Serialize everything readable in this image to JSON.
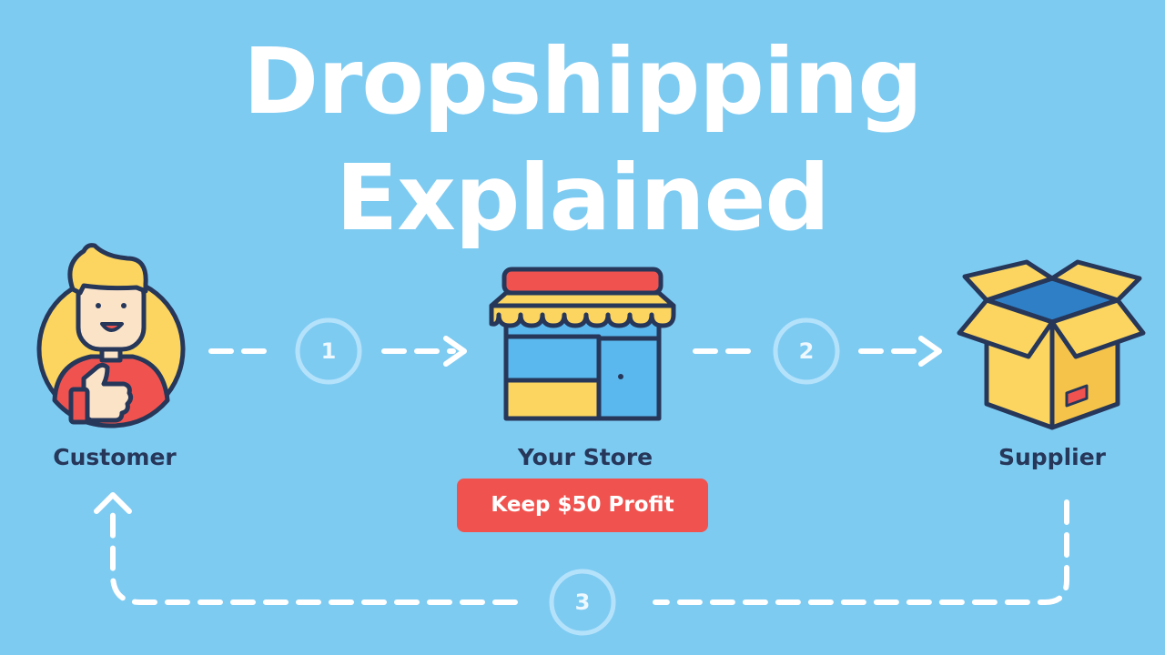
{
  "title": {
    "line1": "Dropshipping",
    "line2": "Explained"
  },
  "nodes": {
    "customer": {
      "label": "Customer",
      "icon": "customer-thumbs-up-icon"
    },
    "store": {
      "label": "Your Store",
      "icon": "storefront-icon"
    },
    "supplier": {
      "label": "Supplier",
      "icon": "open-box-icon"
    }
  },
  "badge": {
    "text": "Keep $50 Profit"
  },
  "steps": [
    {
      "number": "1",
      "from": "customer",
      "to": "store"
    },
    {
      "number": "2",
      "from": "store",
      "to": "supplier"
    },
    {
      "number": "3",
      "from": "supplier",
      "to": "customer"
    }
  ],
  "colors": {
    "background": "#7ecbf2",
    "title": "#ffffff",
    "label": "#26375a",
    "badge": "#f0534f",
    "connector": "#ffffff",
    "outline": "#26375a",
    "yellow": "#fbd560",
    "red": "#f0534f",
    "blue": "#5bb8ee"
  }
}
